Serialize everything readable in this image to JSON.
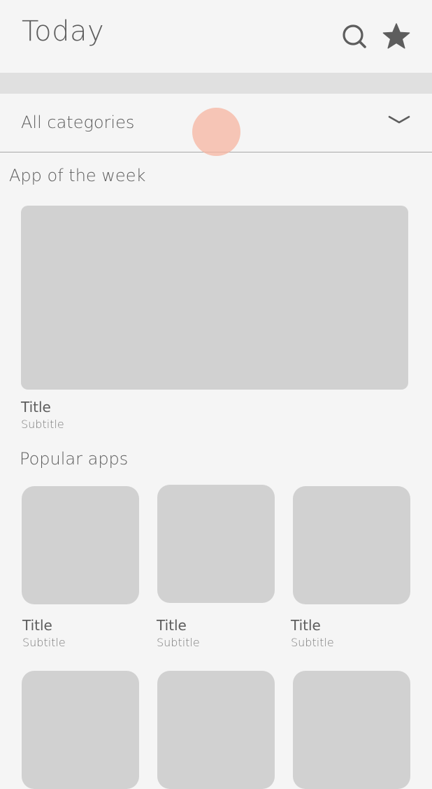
{
  "header": {
    "title": "Today",
    "search_icon": "search-icon",
    "favorites_icon": "star-icon"
  },
  "category_selector": {
    "selected": "All categories",
    "expand_icon": "chevron-down-icon"
  },
  "app_of_the_week": {
    "heading": "App of the week",
    "title": "Title",
    "subtitle": "Subtitle"
  },
  "popular_apps": {
    "heading": "Popular apps",
    "items": [
      {
        "title": "Title",
        "subtitle": "Subtitle"
      },
      {
        "title": "Title",
        "subtitle": "Subtitle"
      },
      {
        "title": "Title",
        "subtitle": "Subtitle"
      }
    ]
  },
  "colors": {
    "background": "#f5f5f5",
    "placeholder": "#d1d1d1",
    "touch_indicator": "#f5b4a0",
    "text": "#5d5d5d"
  }
}
